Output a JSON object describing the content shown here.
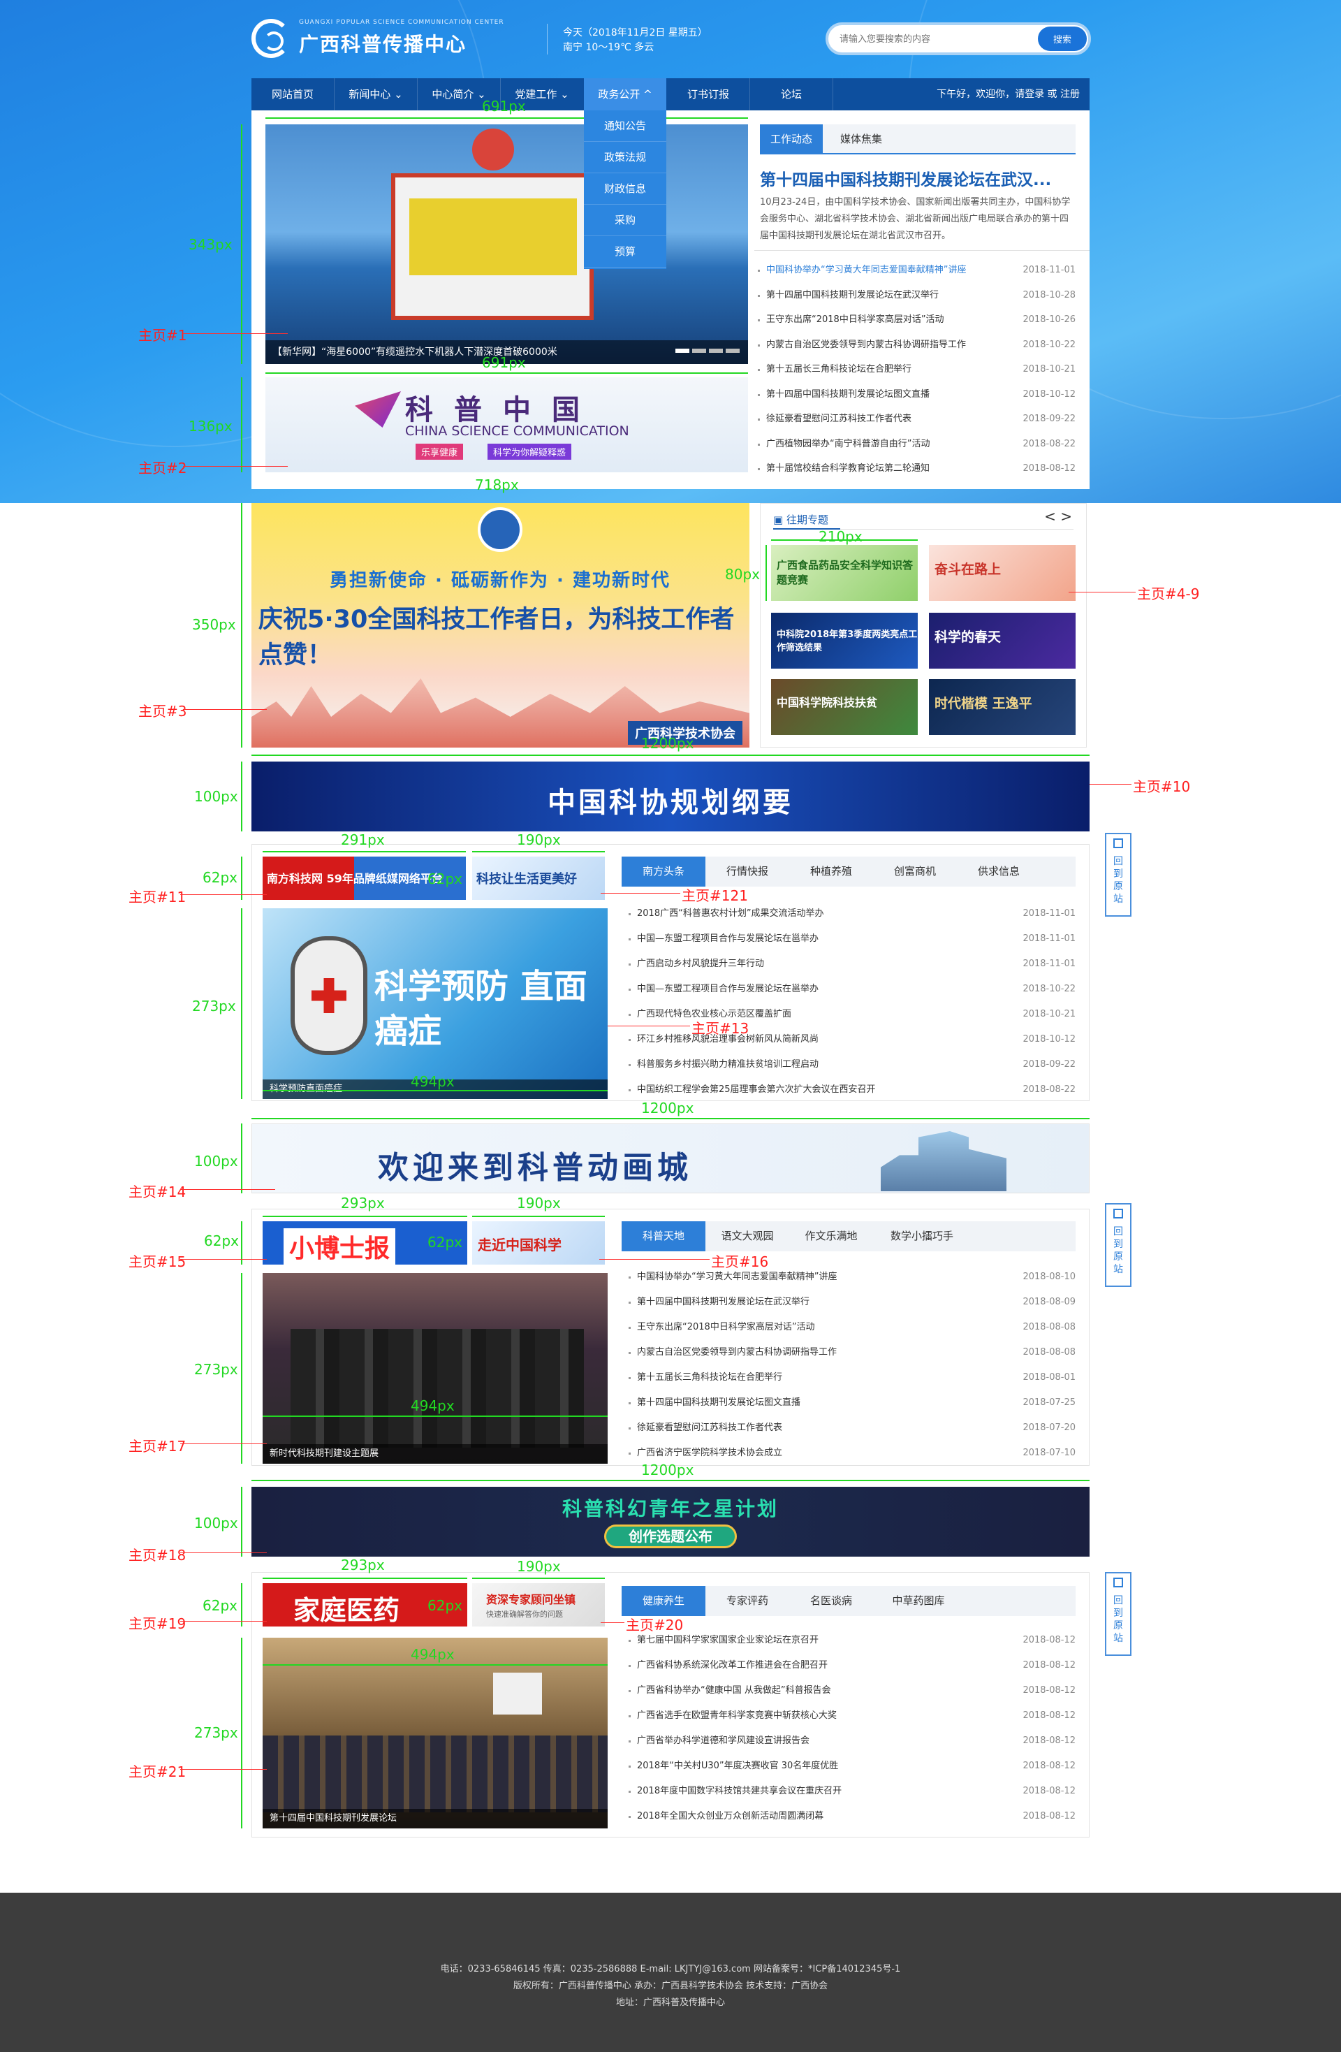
{
  "site": {
    "logo_sub": "GUANGXI POPULAR SCIENCE COMMUNICATION CENTER",
    "logo_title": "广西科普传播中心",
    "date_line": "今天（2018年11月2日 星期五）",
    "weather_line": "南宁 10～19℃ 多云",
    "search_placeholder": "请输入您要搜索的内容",
    "search_button": "搜索"
  },
  "nav": {
    "items": [
      "网站首页",
      "新闻中心",
      "中心简介",
      "党建工作",
      "政务公开",
      "订书订报",
      "论坛"
    ],
    "login": "下午好，欢迎你，请登录 或 注册",
    "dropdown": [
      "通知公告",
      "政策法规",
      "财政信息",
      "采购",
      "预算"
    ]
  },
  "slider": {
    "caption": "【新华网】“海星6000”有缆遥控水下机器人下潜深度首破6000米"
  },
  "banner_china": {
    "title": "科普中国",
    "subtitle": "CHINA SCIENCE COMMUNICATION",
    "tag1": "乐享健康",
    "tag2": "科学为你解疑释惑"
  },
  "news": {
    "tabs": [
      "工作动态",
      "媒体焦集"
    ],
    "headline": "第十四届中国科技期刊发展论坛在武汉...",
    "intro": "10月23-24日，由中国科学技术协会、国家新闻出版署共同主办，中国科协学会服务中心、湖北省科学技术协会、湖北省新闻出版广电局联合承办的第十四届中国科技期刊发展论坛在湖北省武汉市召开。",
    "items": [
      {
        "title": "中国科协举办“学习黄大年同志爱国奉献精神”讲座",
        "date": "2018-11-01"
      },
      {
        "title": "第十四届中国科技期刊发展论坛在武汉举行",
        "date": "2018-10-28"
      },
      {
        "title": "王守东出席“2018中日科学家高层对话”活动",
        "date": "2018-10-26"
      },
      {
        "title": "内蒙古自治区党委领导到内蒙古科协调研指导工作",
        "date": "2018-10-22"
      },
      {
        "title": "第十五届长三角科技论坛在合肥举行",
        "date": "2018-10-21"
      },
      {
        "title": "第十四届中国科技期刊发展论坛图文直播",
        "date": "2018-10-12"
      },
      {
        "title": "徐延豪看望慰问江苏科技工作者代表",
        "date": "2018-09-22"
      },
      {
        "title": "广西植物园举办“南宁科普游自由行”活动",
        "date": "2018-08-22"
      },
      {
        "title": "第十届馆校结合科学教育论坛第二轮通知",
        "date": "2018-08-12"
      }
    ]
  },
  "banner_530": {
    "line1": "勇担新使命 · 砥砺新作为 · 建功新时代",
    "line2": "庆祝5·30全国科技工作者日，为科技工作者点赞！",
    "footer": "广西科学技术协会"
  },
  "special": {
    "title": "往期专题",
    "prev": "<",
    "next": ">",
    "thumbs": [
      "广西食品药品安全科学知识答题竞赛",
      "奋斗在路上",
      "中科院2018年第3季度两类亮点工作筛选结果",
      "科学的春天",
      "中国科学院科技扶贫",
      "时代楷模 王逸平"
    ]
  },
  "banner_plan": {
    "text": "中国科协规划纲要"
  },
  "sec1": {
    "ad_left": "南方科技网 59年品牌纸媒网络平台",
    "ad_right": "科技让生活更美好",
    "tabs": [
      "南方头条",
      "行情快报",
      "种植养殖",
      "创富商机",
      "供求信息"
    ],
    "image_caption": "科学预防直面癌症",
    "image_title": "科学预防 直面癌症",
    "items": [
      {
        "title": "2018广西“科普惠农村计划”成果交流活动举办",
        "date": "2018-11-01"
      },
      {
        "title": "中国—东盟工程项目合作与发展论坛在邕举办",
        "date": "2018-11-01"
      },
      {
        "title": "广西启动乡村风貌提升三年行动",
        "date": "2018-11-01"
      },
      {
        "title": "中国—东盟工程项目合作与发展论坛在邕举办",
        "date": "2018-10-22"
      },
      {
        "title": "广西现代特色农业核心示范区覆盖扩面",
        "date": "2018-10-21"
      },
      {
        "title": "环江乡村推移风貌治理事会树新风从简新风尚",
        "date": "2018-10-12"
      },
      {
        "title": "科普服务乡村振兴助力精准扶贫培训工程启动",
        "date": "2018-09-22"
      },
      {
        "title": "中国纺织工程学会第25届理事会第六次扩大会议在西安召开",
        "date": "2018-08-22"
      }
    ]
  },
  "banner_anim": {
    "text": "欢迎来到科普动画城"
  },
  "sec2": {
    "ad_left": "小博士报",
    "ad_right": "走近中国科学",
    "tabs": [
      "科普天地",
      "语文大观园",
      "作文乐满地",
      "数学小擂巧手"
    ],
    "image_caption": "新时代科技期刊建设主题展",
    "items": [
      {
        "title": "中国科协举办“学习黄大年同志爱国奉献精神”讲座",
        "date": "2018-08-10"
      },
      {
        "title": "第十四届中国科技期刊发展论坛在武汉举行",
        "date": "2018-08-09"
      },
      {
        "title": "王守东出席“2018中日科学家高层对话”活动",
        "date": "2018-08-08"
      },
      {
        "title": "内蒙古自治区党委领导到内蒙古科协调研指导工作",
        "date": "2018-08-08"
      },
      {
        "title": "第十五届长三角科技论坛在合肥举行",
        "date": "2018-08-01"
      },
      {
        "title": "第十四届中国科技期刊发展论坛图文直播",
        "date": "2018-07-25"
      },
      {
        "title": "徐延豪看望慰问江苏科技工作者代表",
        "date": "2018-07-20"
      },
      {
        "title": "广西省济宁医学院科学技术协会成立",
        "date": "2018-07-10"
      }
    ]
  },
  "banner_youth": {
    "line1": "科普科幻青年之星计划",
    "line2": "创作选题公布"
  },
  "sec3": {
    "ad_left": "家庭医药",
    "ad_right": "资深专家顾问坐镇",
    "ad_right_sub": "快速准确解答你的问题",
    "tabs": [
      "健康养生",
      "专家评药",
      "名医谈病",
      "中草药图库"
    ],
    "image_caption": "第十四届中国科技期刊发展论坛",
    "items": [
      {
        "title": "第七届中国科学家家国家企业家论坛在京召开",
        "date": "2018-08-12"
      },
      {
        "title": "广西省科协系统深化改革工作推进会在合肥召开",
        "date": "2018-08-12"
      },
      {
        "title": "广西省科协举办“健康中国 从我做起”科普报告会",
        "date": "2018-08-12"
      },
      {
        "title": "广西省选手在欧盟青年科学家竞赛中斩获核心大奖",
        "date": "2018-08-12"
      },
      {
        "title": "广西省举办科学道德和学风建设宣讲报告会",
        "date": "2018-08-12"
      },
      {
        "title": "2018年“中关村U30”年度决赛收官 30名年度优胜",
        "date": "2018-08-12"
      },
      {
        "title": "2018年度中国数字科技馆共建共享会议在重庆召开",
        "date": "2018-08-12"
      },
      {
        "title": "2018年全国大众创业万众创新活动周圆满闭幕",
        "date": "2018-08-12"
      }
    ]
  },
  "side_button": "回到原站",
  "footer": {
    "line1": "电话：0233-65846145  传真：0235-2586888   E-mail: LKJTYJ@163.com   网站备案号：*ICP备14012345号-1",
    "line2": "版权所有：广西科普传播中心  承办：广西县科学技术协会   技术支持：广西协会",
    "line3": "地址：广西科普及传播中心"
  },
  "annotations": {
    "labels": [
      "主页#1",
      "主页#2",
      "主页#3",
      "主页#4-9",
      "主页#10",
      "主页#11",
      "主页#121",
      "主页#13",
      "主页#14",
      "主页#15",
      "主页#16",
      "主页#17",
      "主页#18",
      "主页#19",
      "主页#20",
      "主页#21"
    ],
    "dims": [
      "691px",
      "343px",
      "691px",
      "136px",
      "718px",
      "350px",
      "210px",
      "80px",
      "1200px",
      "100px",
      "291px",
      "190px",
      "62px",
      "62px",
      "273px",
      "494px",
      "1200px",
      "100px",
      "293px",
      "190px",
      "62px",
      "62px",
      "273px",
      "494px",
      "1200px",
      "100px",
      "293px",
      "190px",
      "62px",
      "62px",
      "273px",
      "494px"
    ]
  }
}
